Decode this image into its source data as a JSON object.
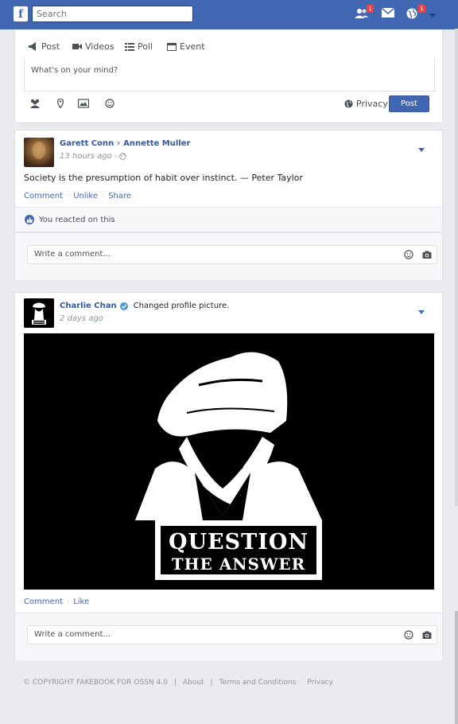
{
  "header": {
    "logo_letter": "f",
    "search_placeholder": "Search",
    "friends_badge": "1",
    "notifications_badge": "1",
    "icons": [
      "users-icon",
      "envelope-icon",
      "globe-icon",
      "chevron-down-icon"
    ]
  },
  "composer": {
    "tabs": [
      {
        "icon": "bullhorn-icon",
        "label": "Post"
      },
      {
        "icon": "video-icon",
        "label": "Videos"
      },
      {
        "icon": "list-icon",
        "label": "Poll"
      },
      {
        "icon": "calendar-icon",
        "label": "Event"
      }
    ],
    "placeholder": "What's on your mind?",
    "actions": [
      "tag-friends-icon",
      "location-icon",
      "photo-icon",
      "emoji-icon"
    ],
    "privacy_label": "Privacy",
    "post_button": "Post"
  },
  "posts": [
    {
      "author": "Garett Conn",
      "target": "Annette Muller",
      "time": "13 hours ago",
      "separator": "-",
      "text": "Society is the presumption of habit over instinct. — Peter Taylor",
      "links": [
        "Comment",
        "Unlike",
        "Share"
      ],
      "reaction": "You reacted on this",
      "comment_placeholder": "Write a comment..."
    },
    {
      "author": "Charlie Chan",
      "action": "Changed profile picture.",
      "time": "2 days ago",
      "image_text_top": "QUESTION",
      "image_text_bottom": "THE ANSWER",
      "links": [
        "Comment",
        "Like"
      ],
      "comment_placeholder": "Write a comment..."
    }
  ],
  "footer": {
    "copyright": "© COPYRIGHT FAKEBOOK FOR OSSN 4.0",
    "sep": "|",
    "links": [
      "About",
      "Terms and Conditions",
      "Privacy"
    ]
  },
  "colors": {
    "brand": "#4267b2",
    "background": "#e9ebee",
    "badge": "#fa3e3e"
  }
}
